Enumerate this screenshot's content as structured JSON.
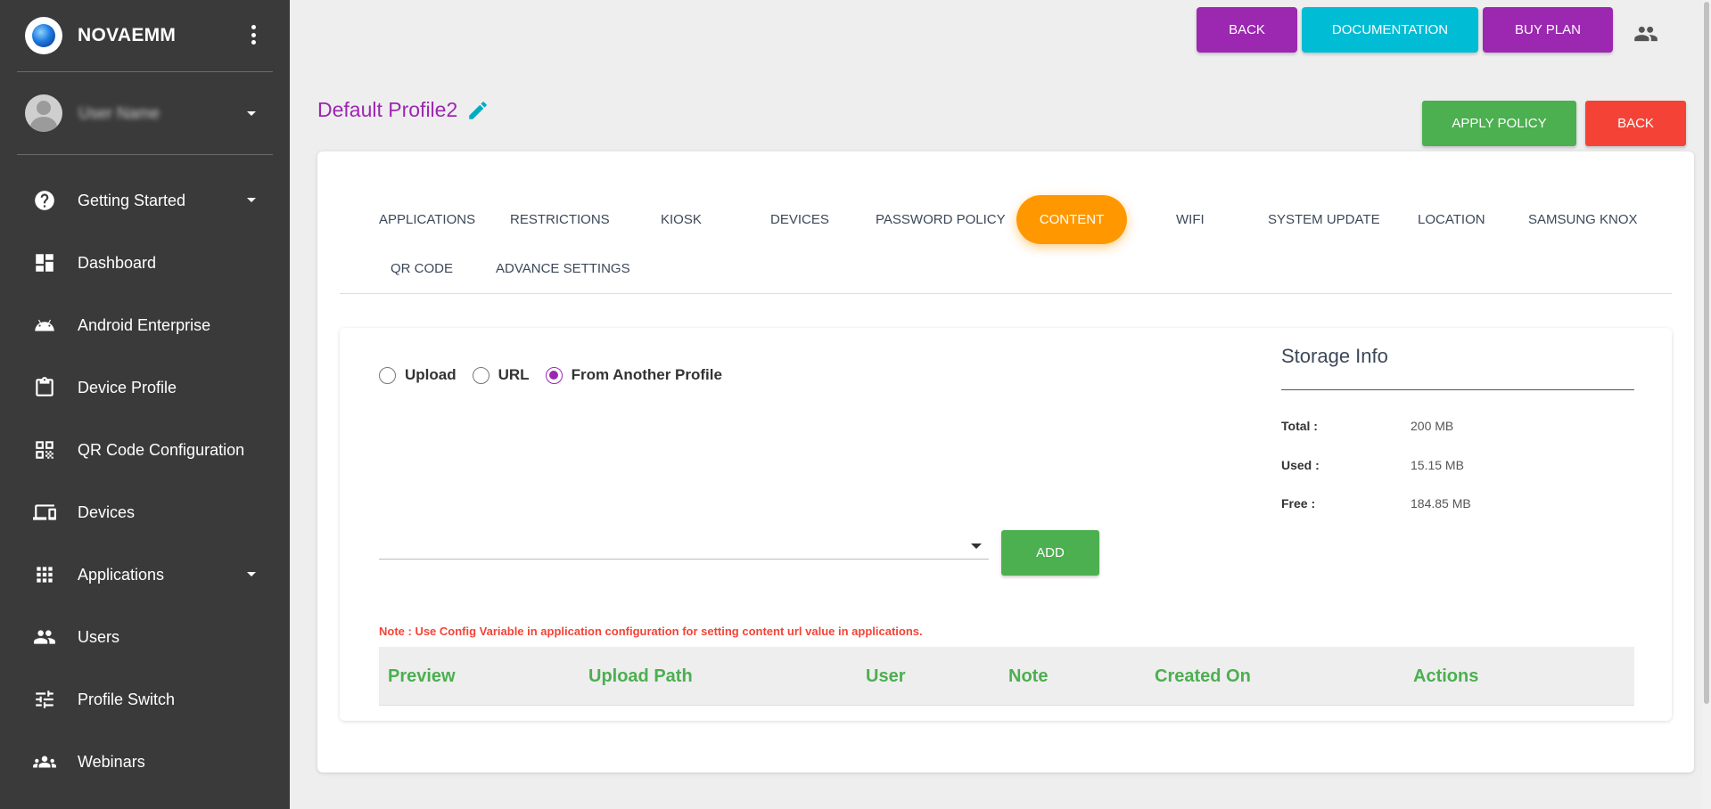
{
  "sidebar": {
    "brand": "NOVAEMM",
    "user_name": "User Name",
    "items": [
      {
        "label": "Getting Started",
        "icon": "help-circle-icon",
        "has_caret": true
      },
      {
        "label": "Dashboard",
        "icon": "dashboard-icon"
      },
      {
        "label": "Android Enterprise",
        "icon": "android-icon"
      },
      {
        "label": "Device Profile",
        "icon": "clipboard-icon"
      },
      {
        "label": "QR Code Configuration",
        "icon": "qr-code-icon"
      },
      {
        "label": "Devices",
        "icon": "devices-icon"
      },
      {
        "label": "Applications",
        "icon": "apps-grid-icon",
        "has_caret": true
      },
      {
        "label": "Users",
        "icon": "users-icon"
      },
      {
        "label": "Profile Switch",
        "icon": "tune-icon"
      },
      {
        "label": "Webinars",
        "icon": "group-icon"
      }
    ]
  },
  "topbar": {
    "back_label": "BACK",
    "docs_label": "DOCUMENTATION",
    "buy_label": "BUY PLAN"
  },
  "page": {
    "title": "Default Profile2",
    "apply_label": "APPLY POLICY",
    "back_label": "BACK"
  },
  "tabs": [
    {
      "label": "APPLICATIONS"
    },
    {
      "label": "RESTRICTIONS"
    },
    {
      "label": "KIOSK"
    },
    {
      "label": "DEVICES"
    },
    {
      "label": "PASSWORD POLICY"
    },
    {
      "label": "CONTENT",
      "active": true
    },
    {
      "label": "WIFI"
    },
    {
      "label": "SYSTEM UPDATE"
    },
    {
      "label": "LOCATION"
    },
    {
      "label": "SAMSUNG KNOX"
    },
    {
      "label": "QR CODE"
    },
    {
      "label": "ADVANCE SETTINGS"
    }
  ],
  "content": {
    "radios": [
      {
        "label": "Upload",
        "checked": false
      },
      {
        "label": "URL",
        "checked": false
      },
      {
        "label": "From Another Profile",
        "checked": true
      }
    ],
    "select_value": "",
    "add_label": "ADD",
    "note": "Note : Use Config Variable in application configuration for setting content url value in applications.",
    "table_headers": [
      "Preview",
      "Upload Path",
      "User",
      "Note",
      "Created On",
      "Actions"
    ]
  },
  "storage": {
    "title": "Storage Info",
    "rows": [
      {
        "key": "Total :",
        "value": "200 MB"
      },
      {
        "key": "Used :",
        "value": "15.15 MB"
      },
      {
        "key": "Free :",
        "value": "184.85 MB"
      }
    ]
  },
  "colors": {
    "sidebar_bg": "#3a3a3b",
    "purple": "#9c27b0",
    "cyan": "#00bcd4",
    "green": "#4caf50",
    "red": "#f44336",
    "orange": "#ff9800"
  }
}
